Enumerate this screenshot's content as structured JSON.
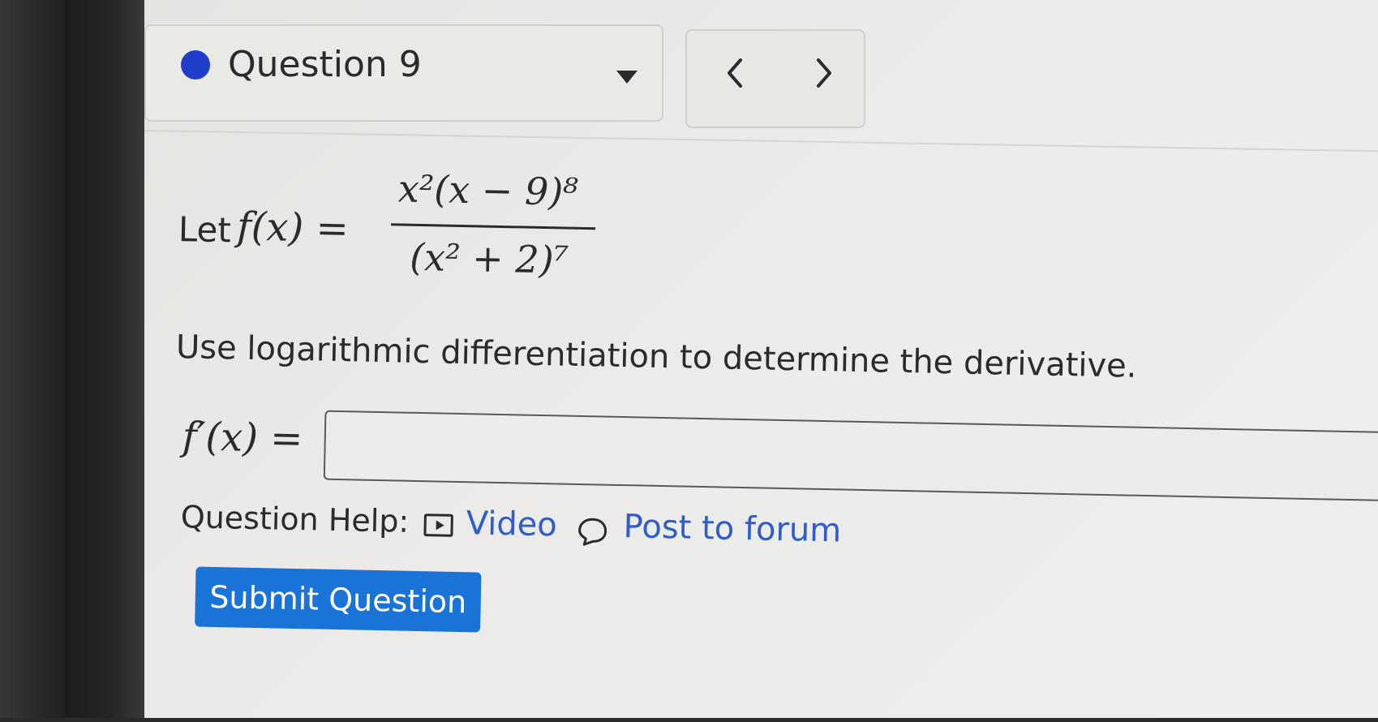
{
  "question_nav": {
    "label": "Question 9",
    "status_color": "#1e3dc8",
    "caret_icon": "caret-down-icon",
    "prev_icon": "chevron-left-icon",
    "next_icon": "chevron-right-icon"
  },
  "problem": {
    "let_label": "Let",
    "function_lhs": "f(x) =",
    "numerator": "x²(x − 9)⁸",
    "denominator": "(x² + 2)⁷",
    "instruction": "Use logarithmic differentiation to determine the derivative.",
    "answer_lhs": "f′(x) =",
    "answer_value": ""
  },
  "help": {
    "label": "Question Help:",
    "video_label": "Video",
    "video_icon": "video-icon",
    "forum_label": "Post to forum",
    "forum_icon": "speech-bubble-icon"
  },
  "submit_label": "Submit Question",
  "colors": {
    "link": "#2f5dc8",
    "submit": "#1a73d6"
  }
}
